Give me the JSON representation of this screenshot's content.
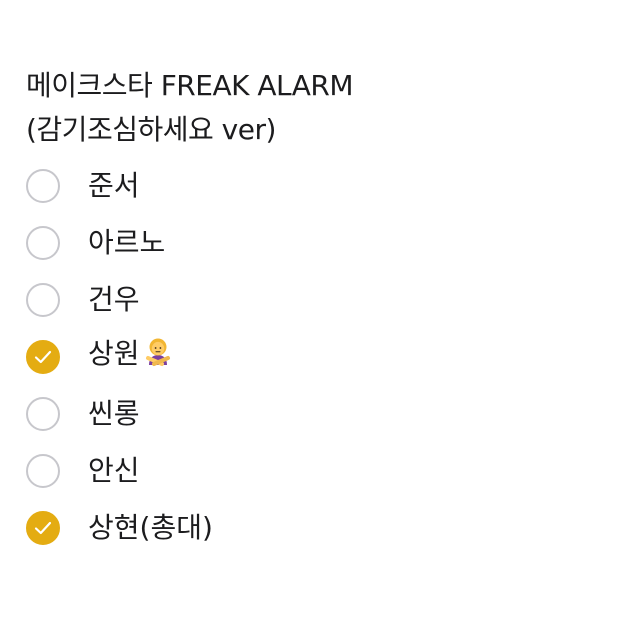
{
  "note": {
    "title_line1": "메이크스타 FREAK ALARM",
    "title_line2": "(감기조심하세요 ver)"
  },
  "checklist": {
    "items": [
      {
        "label": "준서",
        "checked": false
      },
      {
        "label": "아르노",
        "checked": false
      },
      {
        "label": "건우",
        "checked": false
      },
      {
        "label": "상원",
        "checked": true,
        "icon": "person-crossing-arms-emoji"
      },
      {
        "label": "씬롱",
        "checked": false
      },
      {
        "label": "안신",
        "checked": false
      },
      {
        "label": "상현(총대)",
        "checked": true
      }
    ]
  },
  "colors": {
    "check_fill": "#e4ac12",
    "unchecked_border": "#c7c7cc",
    "text": "#1c1c1e"
  }
}
